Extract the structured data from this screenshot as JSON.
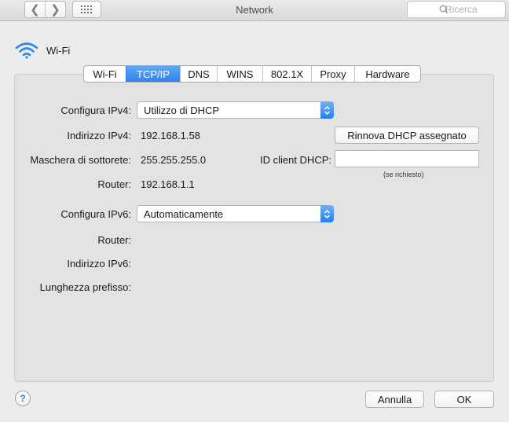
{
  "toolbar": {
    "title": "Network",
    "back_glyph": "❮",
    "forward_glyph": "❯",
    "search_placeholder": "Ricerca"
  },
  "interface": {
    "name": "Wi-Fi",
    "icon": "wifi-icon"
  },
  "tabs": [
    {
      "label": "Wi-Fi",
      "active": false
    },
    {
      "label": "TCP/IP",
      "active": true
    },
    {
      "label": "DNS",
      "active": false
    },
    {
      "label": "WINS",
      "active": false
    },
    {
      "label": "802.1X",
      "active": false
    },
    {
      "label": "Proxy",
      "active": false
    },
    {
      "label": "Hardware",
      "active": false
    }
  ],
  "ipv4": {
    "configure_label": "Configura IPv4:",
    "configure_value": "Utilizzo di DHCP",
    "address_label": "Indirizzo IPv4:",
    "address_value": "192.168.1.58",
    "subnet_label": "Maschera di sottorete:",
    "subnet_value": "255.255.255.0",
    "router_label": "Router:",
    "router_value": "192.168.1.1",
    "renew_button": "Rinnova DHCP assegnato",
    "client_id_label": "ID client DHCP:",
    "client_id_value": "",
    "client_id_hint": "(se richiesto)"
  },
  "ipv6": {
    "configure_label": "Configura IPv6:",
    "configure_value": "Automaticamente",
    "router_label": "Router:",
    "address_label": "Indirizzo IPv6:",
    "prefix_label": "Lunghezza prefisso:"
  },
  "footer": {
    "help_glyph": "?",
    "cancel_button": "Annulla",
    "ok_button": "OK"
  },
  "colors": {
    "accent": "#2f83ee",
    "panel": "#e3e3e3",
    "window": "#ececec"
  }
}
